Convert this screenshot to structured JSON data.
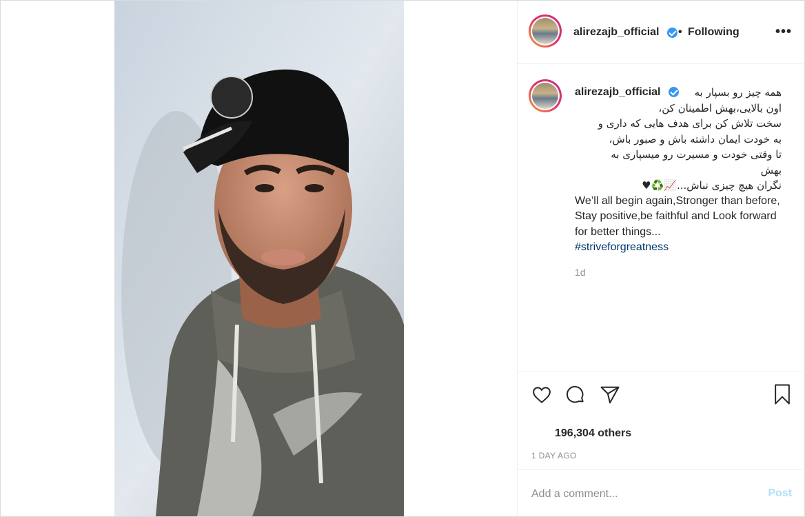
{
  "header": {
    "username": "alirezajb_official",
    "dot": "•",
    "follow_status": "Following",
    "more_label": "•••"
  },
  "caption": {
    "username": "alirezajb_official",
    "persian_lines": [
      "همه چیز رو بسپار به",
      "اون بالایی،بهش اطمینان کن،",
      "سخت تلاش کن برای هدف هایی که داری و",
      "به خودت ایمان داشته باش و صبور باش،",
      "تا وقتی خودت و مسیرت رو میسپاری به",
      "بهش",
      "نگران هیچ چیزی نباش...📈♻️♥"
    ],
    "english_text": "We’ll all begin again,Stronger than before, Stay positive,be faithful and Look forward for better things...",
    "hashtag": "#striveforgreatness",
    "time": "1d"
  },
  "actions": {
    "likes": "196,304 others",
    "time_ago": "1 DAY AGO"
  },
  "comment": {
    "placeholder": "Add a comment...",
    "post_label": "Post"
  },
  "colors": {
    "verified": "#3897f0",
    "hashtag": "#00376b",
    "post_disabled": "#b2dffc",
    "muted": "#8e8e8e"
  },
  "icons": [
    "heart-icon",
    "comment-icon",
    "share-icon",
    "bookmark-icon",
    "verified-badge-icon",
    "more-options-icon"
  ]
}
